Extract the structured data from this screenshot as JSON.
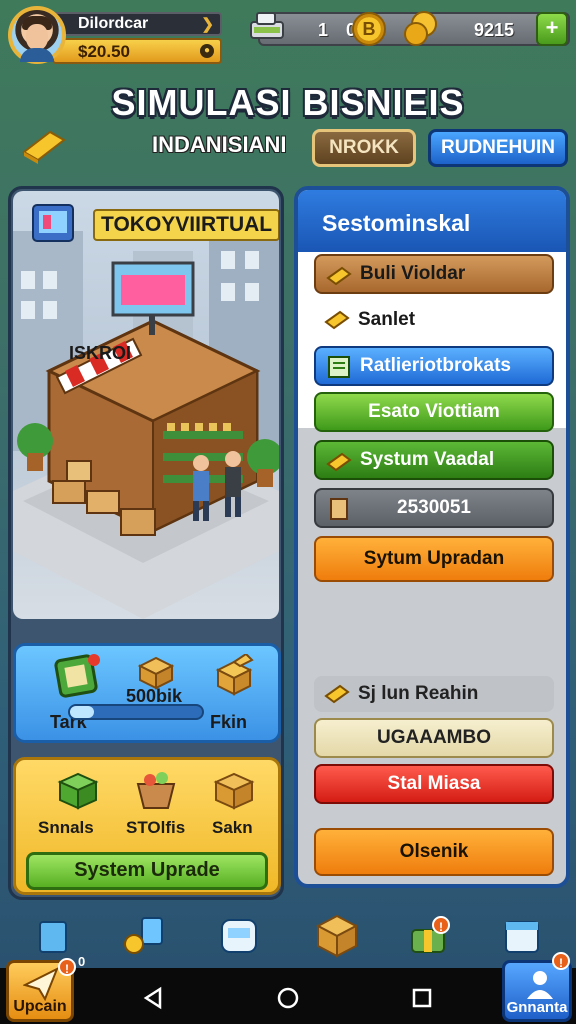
{
  "player": {
    "name": "Dilordcar",
    "money": "$20.50",
    "money_icon": "coin-icon"
  },
  "resources": {
    "cash_value": "1",
    "gear_value": "0",
    "gear_symbol": "B",
    "coin_value": "9215",
    "add_symbol": "+"
  },
  "header": {
    "title": "SIMULASI BISNIEIS",
    "subtitle": "INDANISIANI",
    "work_button": "NROKK",
    "blue_button": "RUDNEHUIN"
  },
  "store": {
    "title": "TOKOYVIIRTUAL",
    "sign": "ISKROI"
  },
  "stats": {
    "left_label": "Tark",
    "middle_value": "500bik",
    "right_label": "Fkin",
    "progress": 0.18
  },
  "items": {
    "labels": [
      "Snnals",
      "STOlfis",
      "Sakn"
    ],
    "upgrade_button": "System Uprade"
  },
  "menu": {
    "header": "Sestominskal",
    "rows": {
      "r1": "Buli Violdar",
      "r2": "Sanlet",
      "r3": "Ratlieriotbrokats",
      "r4": "Esato Viottiam",
      "r5": "Systum Vaadal",
      "r6": "2530051",
      "r7": "Sytum Upradan",
      "r8": "Sj lun Reahin",
      "r9": "UGAAAMBO",
      "r10": "Stal Miasa",
      "r11": "Olsenik"
    }
  },
  "bottom": {
    "upgrade_label": "Upcain",
    "upgrade_badge": "!",
    "upgrade_count": "0",
    "general_label": "Gnnanta",
    "gift_badge": "!",
    "general_badge": "!"
  },
  "colors": {
    "accent_gold": "#f2c33a",
    "primary_blue": "#1d62c9",
    "success_green": "#58b022",
    "danger_red": "#d41d14",
    "warning_orange": "#ef7d0d"
  }
}
